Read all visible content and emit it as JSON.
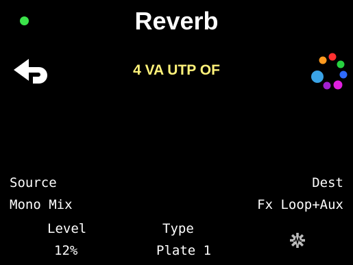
{
  "header": {
    "title": "Reverb",
    "subtitle": "4 VA UTP OF",
    "status_color": "#3BE34A",
    "subtitle_color": "#FFF27A"
  },
  "icons": {
    "back": "back-arrow-icon",
    "color_wheel": "color-wheel-icon",
    "settings": "gear-icon",
    "color_wheel_dots": [
      "#FF9A1F",
      "#FF3030",
      "#27D13F",
      "#2F6BFF",
      "#E020E0",
      "#A020D0",
      "#3AA3E6"
    ]
  },
  "routing": {
    "source_label": "Source",
    "source_value": "Mono Mix",
    "dest_label": "Dest",
    "dest_value": "Fx Loop+Aux"
  },
  "params": {
    "level_label": "Level",
    "level_value": "12%",
    "type_label": "Type",
    "type_value": "Plate 1"
  }
}
